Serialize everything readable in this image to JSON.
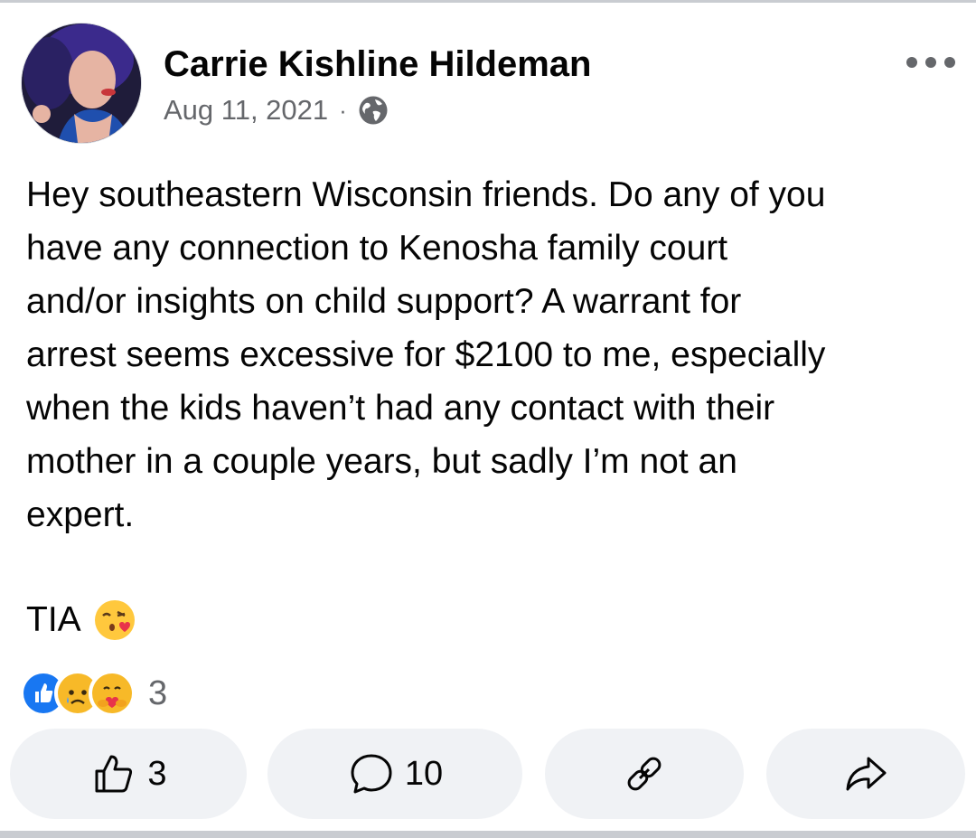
{
  "post": {
    "author": "Carrie Kishline Hildeman",
    "date": "Aug 11, 2021",
    "separator": "·",
    "privacy_icon": "globe-icon",
    "more_icon": "more-options-icon",
    "text": "Hey southeastern Wisconsin friends. Do any of you\nhave any connection to Kenosha family court\nand/or insights on child support? A warrant for\narrest seems excessive for $2100 to me, especially\nwhen the kids haven’t had any contact with their\nmother in a couple years, but sadly I’m not an\nexpert.",
    "sign_off": "TIA",
    "sign_off_emoji": "kissing-heart-emoji"
  },
  "reactions": {
    "icons": [
      "like-reaction-icon",
      "sad-reaction-icon",
      "care-reaction-icon"
    ],
    "count": "3"
  },
  "actions": {
    "like_count": "3",
    "comment_count": "10",
    "like_icon": "thumbs-up-icon",
    "comment_icon": "comment-bubble-icon",
    "link_icon": "link-icon",
    "share_icon": "share-arrow-icon"
  },
  "colors": {
    "text": "#050505",
    "secondary": "#65676b",
    "button_bg": "#f0f2f5",
    "like_blue": "#1877f2"
  }
}
